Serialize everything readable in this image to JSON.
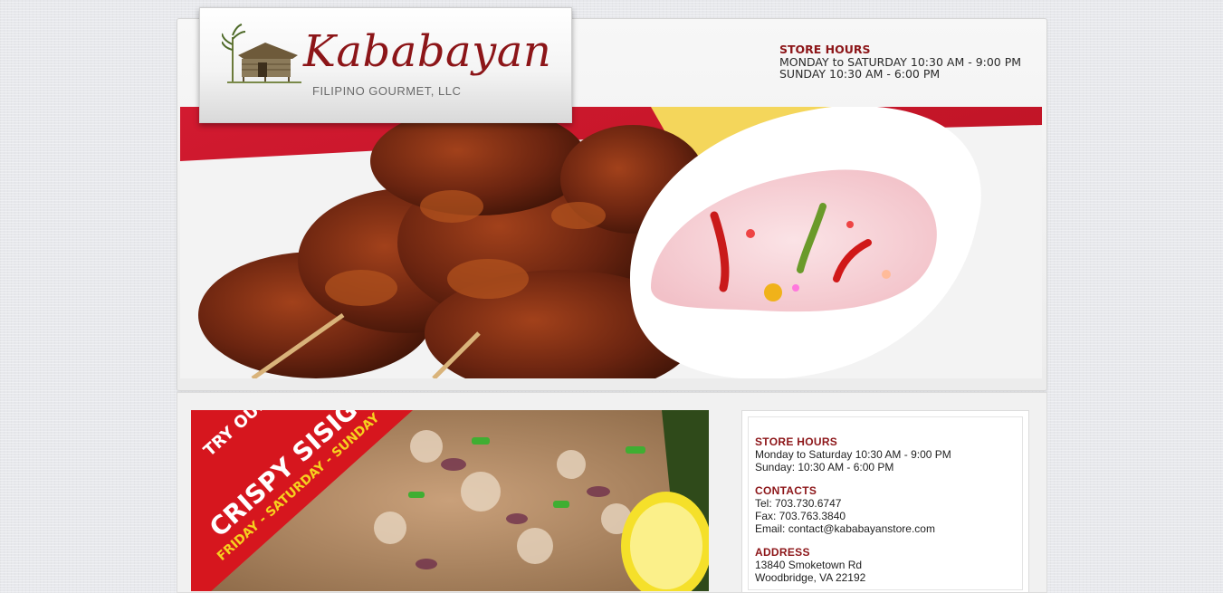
{
  "logo": {
    "brand": "Kababayan",
    "subtitle": "FILIPINO GOURMET, LLC"
  },
  "header_hours": {
    "title": "STORE HOURS",
    "line1": "MONDAY to SATURDAY 10:30 AM - 9:00 PM",
    "line2": "SUNDAY 10:30 AM - 6:00 PM"
  },
  "promo": {
    "line1": "TRY OUR NEW",
    "line2": "CRISPY SISIG!",
    "line3": "FRIDAY - SATURDAY - SUNDAY"
  },
  "sidebar": {
    "hours": {
      "title": "STORE HOURS",
      "line1": "Monday to Saturday 10:30 AM - 9:00 PM",
      "line2": "Sunday: 10:30 AM - 6:00 PM"
    },
    "contacts": {
      "title": "CONTACTS",
      "tel": "Tel: 703.730.6747",
      "fax": "Fax: 703.763.3840",
      "email_label": "Email: ",
      "email": "contact@kababayanstore.com"
    },
    "address": {
      "title": "ADDRESS",
      "line1": "13840 Smoketown Rd",
      "line2": "Woodbridge, VA 22192"
    }
  },
  "colors": {
    "brand_red": "#8c1518",
    "page_bg": "#e7e8ec"
  }
}
